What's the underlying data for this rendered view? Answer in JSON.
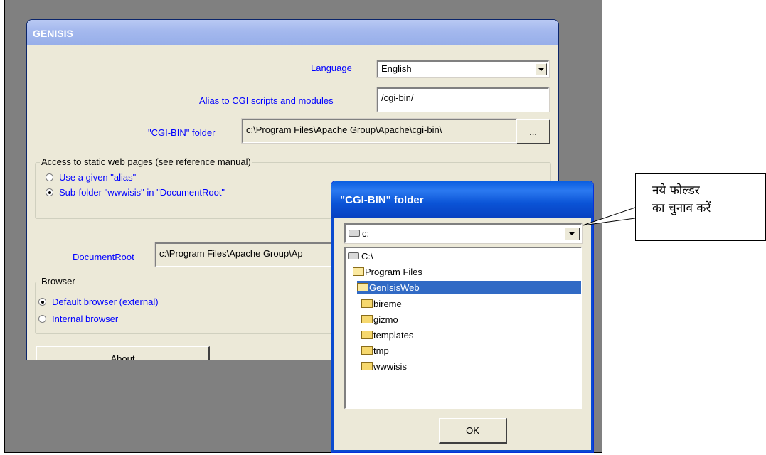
{
  "main_window": {
    "title": "GENISIS",
    "language_label": "Language",
    "language_value": "English",
    "alias_label": "Alias to CGI scripts and modules",
    "alias_value": "/cgi-bin/",
    "cgibin_label": "\"CGI-BIN\" folder",
    "cgibin_value": "c:\\Program Files\\Apache Group\\Apache\\cgi-bin\\",
    "browse_button": "...",
    "static_group_label": "Access to static web pages (see reference manual)",
    "static_options": [
      {
        "label": "Use a given \"alias\"",
        "selected": false
      },
      {
        "label": "Sub-folder \"wwwisis\" in \"DocumentRoot\"",
        "selected": true
      }
    ],
    "documentroot_label": "DocumentRoot",
    "documentroot_value": "c:\\Program Files\\Apache Group\\Ap",
    "browser_group_label": "Browser",
    "browser_options": [
      {
        "label": "Default browser (external)",
        "selected": true
      },
      {
        "label": "Internal browser",
        "selected": false
      }
    ],
    "about_button": "About"
  },
  "folder_dialog": {
    "title": "\"CGI-BIN\" folder",
    "drive_value": "c:",
    "tree": [
      {
        "label": "C:\\",
        "icon": "drive-icon",
        "level": 0,
        "selected": false
      },
      {
        "label": "Program Files",
        "icon": "open-folder-icon",
        "level": 0,
        "selected": false
      },
      {
        "label": "GenIsisWeb",
        "icon": "open-folder-icon",
        "level": 0,
        "selected": true
      },
      {
        "label": "bireme",
        "icon": "folder-icon",
        "level": 1,
        "selected": false
      },
      {
        "label": "gizmo",
        "icon": "folder-icon",
        "level": 1,
        "selected": false
      },
      {
        "label": "templates",
        "icon": "folder-icon",
        "level": 1,
        "selected": false
      },
      {
        "label": "tmp",
        "icon": "folder-icon",
        "level": 1,
        "selected": false
      },
      {
        "label": "wwwisis",
        "icon": "folder-icon",
        "level": 1,
        "selected": false
      }
    ],
    "ok_button": "OK"
  },
  "callout": {
    "line1": "नये फोल्डर",
    "line2": "का चुनाव करें"
  },
  "colors": {
    "label_blue": "#0000ff",
    "dialog_title_blue": "#0a5ee0",
    "selection_blue": "#316ac5",
    "window_face": "#ece9d8"
  }
}
